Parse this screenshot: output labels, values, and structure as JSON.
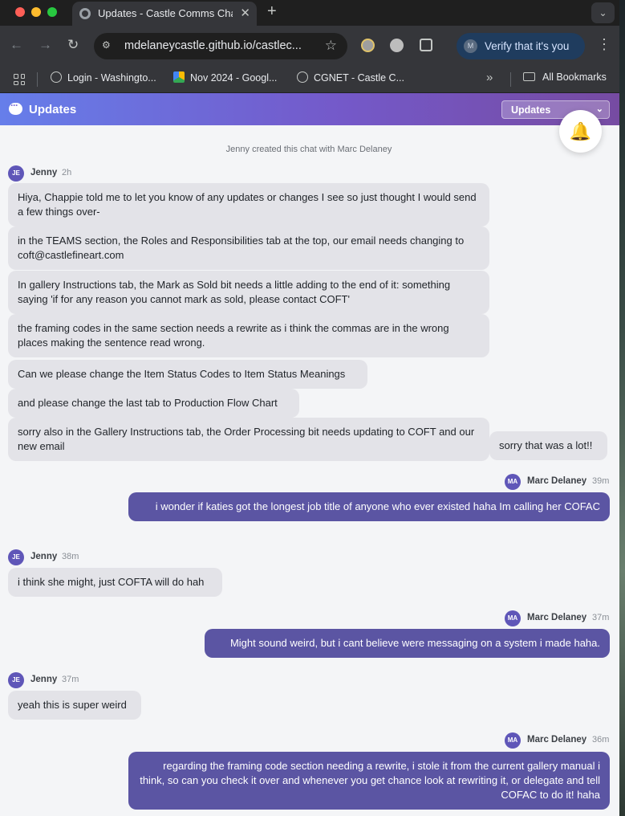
{
  "browser": {
    "tab_title": "Updates - Castle Comms Cha",
    "url": "mdelaneycastle.github.io/castlec...",
    "verify_label": "Verify that it's you",
    "verify_avatar": "M",
    "bookmarks": [
      {
        "label": "Login - Washingto..."
      },
      {
        "label": "Nov 2024 - Googl..."
      },
      {
        "label": "CGNET - Castle C..."
      }
    ],
    "all_bookmarks_label": "All Bookmarks"
  },
  "app": {
    "title": "Updates",
    "chat_select_value": "Updates",
    "system_note": "Jenny created this chat with Marc Delaney"
  },
  "messages": [
    {
      "sender": "Jenny",
      "initials": "JE",
      "time": "2h",
      "direction": "in",
      "texts": [
        "Hiya, Chappie told me to let you know of any updates or changes I see so just thought I would send a few things over-",
        "in the TEAMS section, the Roles and Responsibilities tab at the top, our email needs changing to coft@castlefineart.com",
        "In gallery Instructions tab, the Mark as Sold bit needs a little adding to the end of it: something saying 'if for any reason you cannot mark as sold, please contact COFT'",
        "the framing codes in the same section needs a rewrite as i think the commas are in the wrong places making the sentence read wrong.",
        "Can we please change the Item Status Codes to Item Status Meanings",
        "and please change the last tab to Production Flow Chart",
        "sorry also in the Gallery Instructions tab, the Order Processing bit needs updating to COFT and our new email",
        "sorry that was a lot!!"
      ]
    },
    {
      "sender": "Marc Delaney",
      "initials": "MA",
      "time": "39m",
      "direction": "out",
      "texts": [
        "i wonder if katies got the longest job title of anyone who ever existed haha Im calling her COFAC"
      ]
    },
    {
      "sender": "Jenny",
      "initials": "JE",
      "time": "38m",
      "direction": "in",
      "texts": [
        "i think she might, just COFTA will do hah"
      ]
    },
    {
      "sender": "Marc Delaney",
      "initials": "MA",
      "time": "37m",
      "direction": "out",
      "texts": [
        "Might sound weird, but i cant believe were messaging on a system i made haha."
      ]
    },
    {
      "sender": "Jenny",
      "initials": "JE",
      "time": "37m",
      "direction": "in",
      "texts": [
        "yeah this is super weird"
      ]
    },
    {
      "sender": "Marc Delaney",
      "initials": "MA",
      "time": "36m",
      "direction": "out",
      "texts": [
        "regarding the framing code section needing a rewrite, i stole it from the current gallery manual i think, so can you check it over and whenever you get chance look at rewriting it, or delegate and tell COFAC to do it! haha"
      ]
    }
  ]
}
